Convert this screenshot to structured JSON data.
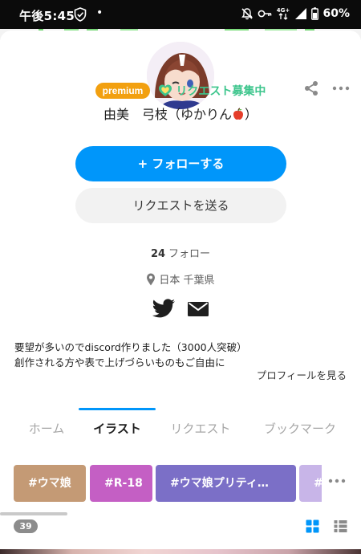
{
  "status_bar": {
    "time": "午後5:45",
    "dot": "•",
    "network": "4G+",
    "battery": "60%"
  },
  "profile": {
    "premium_label": "premium",
    "request_status": "リクエスト募集中",
    "username": "由美　弓枝（ゆかりん",
    "username_suffix": "）"
  },
  "buttons": {
    "follow": "+ フォローする",
    "request": "リクエストを送る"
  },
  "stats": {
    "follow_count": "24",
    "follow_label": "フォロー",
    "location": "日本 千葉県"
  },
  "bio": {
    "line1": "要望が多いのでdiscord作りました（3000人突破）",
    "line2": "創作される方や表で上げづらいものもご自由に",
    "see_profile": "プロフィールを見る"
  },
  "tabs": [
    {
      "label": "ホーム",
      "active": false
    },
    {
      "label": "イラスト",
      "active": true
    },
    {
      "label": "リクエスト",
      "active": false
    },
    {
      "label": "ブックマーク",
      "active": false
    }
  ],
  "tags": [
    {
      "label": "#ウマ娘",
      "color": "#c49a75"
    },
    {
      "label": "#R-18",
      "color": "#c45fc4"
    },
    {
      "label": "#ウマ娘プリティ…",
      "color": "#7b6fc7"
    },
    {
      "label": "#",
      "color": "#c8b5e8"
    }
  ],
  "results": {
    "count": "39"
  },
  "colors": {
    "accent": "#0096fa",
    "request_green": "#3cc58c",
    "premium": "#f2a010"
  },
  "icons": {
    "share": "share-icon",
    "more": "more-icon",
    "twitter": "twitter-icon",
    "mail": "mail-icon",
    "grid": "grid-view-icon",
    "list": "list-view-icon"
  }
}
